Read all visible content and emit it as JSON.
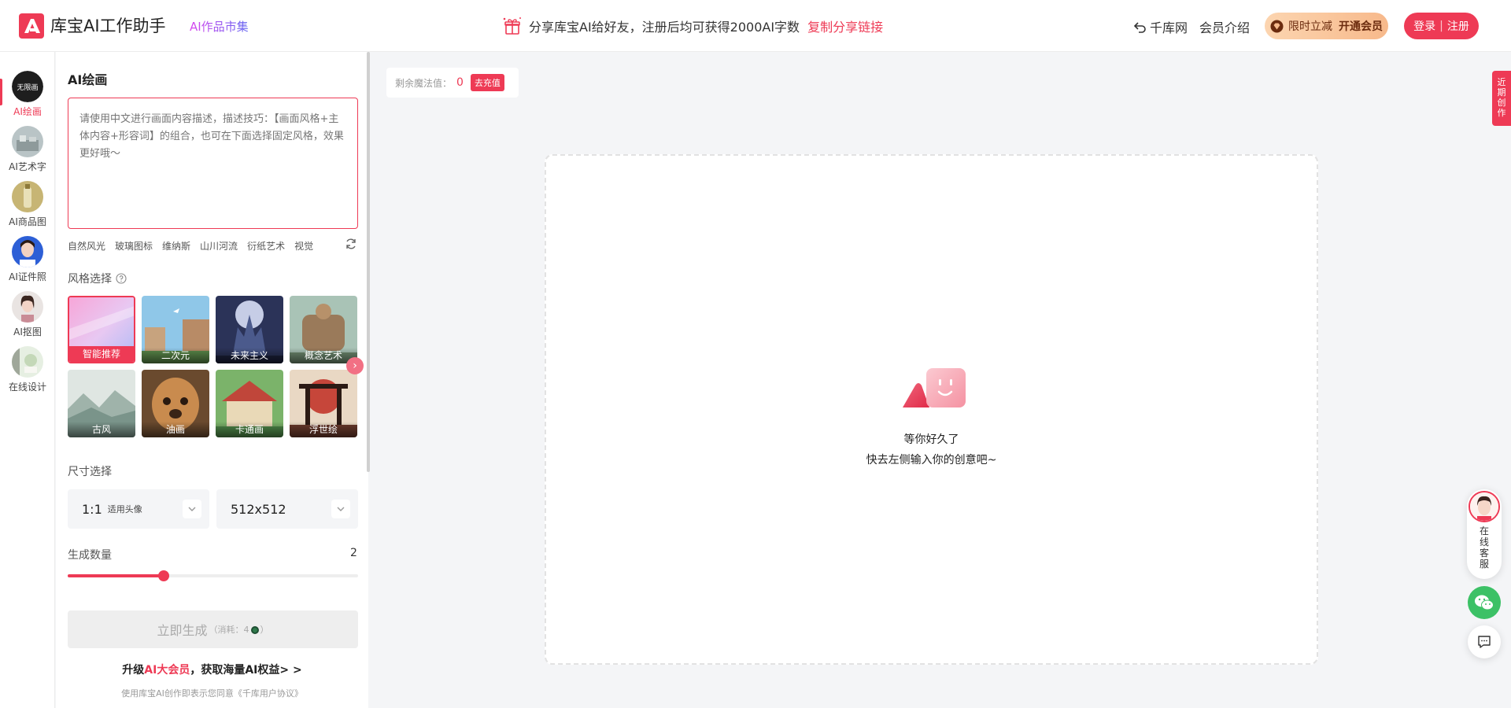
{
  "header": {
    "app_title": "库宝AI工作助手",
    "works_market": "AI作品市集",
    "share_text": "分享库宝AI给好友，注册后均可获得2000AI字数",
    "share_link": "复制分享链接",
    "nav_qianku": "千库网",
    "nav_member": "会员介绍",
    "vip_prefix": "限时立减",
    "vip_label": "开通会员",
    "login": "登录",
    "register": "注册",
    "login_separator": "|"
  },
  "rail": {
    "items": [
      {
        "label": "AI绘画",
        "badge": "无限画",
        "active": true
      },
      {
        "label": "AI艺术字"
      },
      {
        "label": "AI商品图"
      },
      {
        "label": "AI证件照"
      },
      {
        "label": "AI抠图"
      },
      {
        "label": "在线设计"
      }
    ]
  },
  "panel": {
    "title": "AI绘画",
    "prompt_placeholder": "请使用中文进行画面内容描述，描述技巧：【画面风格+主体内容+形容词】的组合，也可在下面选择固定风格，效果更好哦～",
    "tags": [
      "自然风光",
      "玻璃图标",
      "维纳斯",
      "山川河流",
      "衍纸艺术",
      "视觉"
    ],
    "style_heading": "风格选择",
    "styles": [
      {
        "label": "智能推荐",
        "selected": true
      },
      {
        "label": "二次元"
      },
      {
        "label": "未来主义"
      },
      {
        "label": "概念艺术"
      },
      {
        "label": "古风"
      },
      {
        "label": "油画"
      },
      {
        "label": "卡通画"
      },
      {
        "label": "浮世绘"
      }
    ],
    "size_heading": "尺寸选择",
    "ratio_value": "1:1",
    "ratio_hint": "适用头像",
    "resolution_value": "512x512",
    "count_heading": "生成数量",
    "count_value": "2",
    "count_slider_fraction": 0.33,
    "generate_label": "立即生成",
    "generate_cost_prefix": "（消耗：4",
    "generate_cost_suffix": "）",
    "upgrade_prefix": "升级",
    "upgrade_highlight": "AI大会员",
    "upgrade_suffix": "，获取海量AI权益> >",
    "agreement": "使用库宝AI创作即表示您同意《千库用户协议》"
  },
  "main": {
    "magic_label": "剩余魔法值：",
    "magic_value": "0",
    "recharge": "去充值",
    "empty_line1": "等你好久了",
    "empty_line2": "快去左侧输入你的创意吧~"
  },
  "floating": {
    "recent": "近期创作",
    "service": "在线客服"
  },
  "colors": {
    "accent": "#ee3a55",
    "vip_gradient_start": "#fcd5b0",
    "vip_gradient_end": "#f7b98b",
    "wechat": "#3cc166"
  }
}
